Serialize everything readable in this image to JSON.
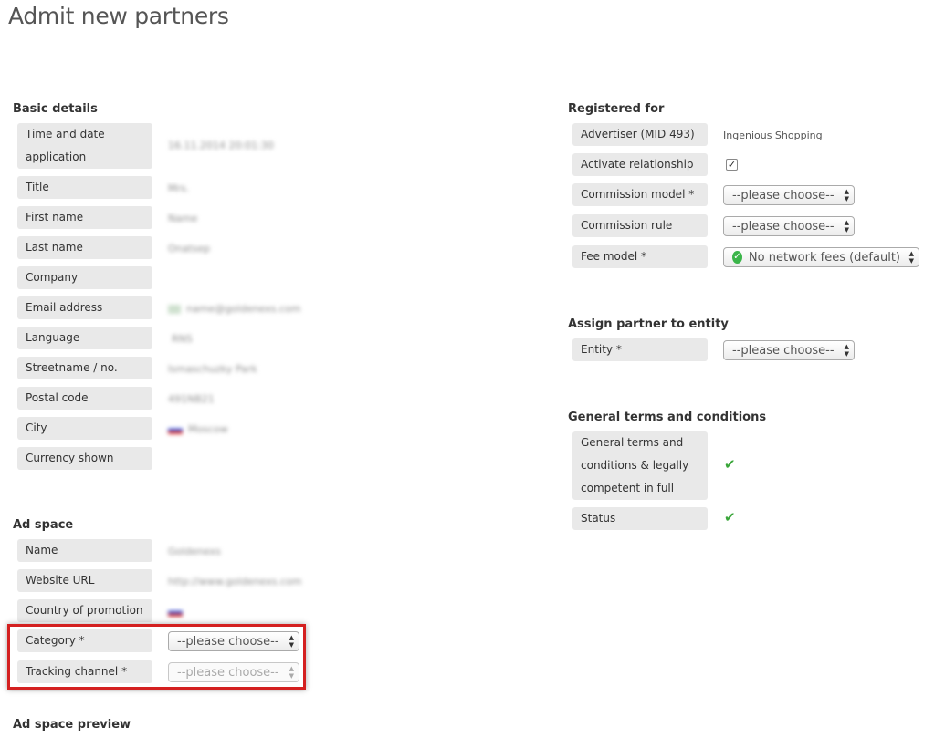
{
  "page": {
    "title": "Admit new partners"
  },
  "basic_details": {
    "heading": "Basic details",
    "fields": [
      {
        "label_line1": "Time and date",
        "label_line2": "application",
        "value": "16.11.2014 20:01:30"
      },
      {
        "label": "Title",
        "value": "Mrs."
      },
      {
        "label": "First name",
        "value": "Name"
      },
      {
        "label": "Last name",
        "value": "Onatsep"
      },
      {
        "label": "Company",
        "value": ""
      },
      {
        "label": "Email address",
        "value": "name@goldenexs.com"
      },
      {
        "label": "Language",
        "value": "RNS"
      },
      {
        "label": "Streetname / no.",
        "value": "Ismaschuzky Park"
      },
      {
        "label": "Postal code",
        "value": "491NB21"
      },
      {
        "label": "City",
        "value": "Moscow"
      },
      {
        "label": "Currency shown",
        "value": ""
      }
    ]
  },
  "ad_space": {
    "heading": "Ad space",
    "fields": [
      {
        "label": "Name",
        "value": "Goldenexs"
      },
      {
        "label": "Website URL",
        "value": "http://www.goldenexs.com"
      },
      {
        "label": "Country of promotion",
        "value": ""
      },
      {
        "label": "Category *",
        "select": "--please choose--"
      },
      {
        "label": "Tracking channel *",
        "select": "--please choose--"
      }
    ]
  },
  "ad_space_preview": {
    "heading": "Ad space preview"
  },
  "registered_for": {
    "heading": "Registered for",
    "advertiser_label": "Advertiser (MID 493)",
    "advertiser_value": "Ingenious Shopping",
    "activate_label": "Activate relationship",
    "activate_checked": true,
    "activate_mark": "✓",
    "commission_model_label": "Commission model *",
    "commission_model_select": "--please choose--",
    "commission_rule_label": "Commission rule",
    "commission_rule_select": "--please choose--",
    "fee_model_label": "Fee model *",
    "fee_model_select": "No network fees (default)"
  },
  "assign_entity": {
    "heading": "Assign partner to entity",
    "entity_label": "Entity *",
    "entity_select": "--please choose--"
  },
  "terms": {
    "heading": "General terms and conditions",
    "gtc_line1": "General terms and",
    "gtc_line2": "conditions & legally",
    "gtc_line3": "competent in full",
    "status_label": "Status",
    "check_mark": "✔"
  },
  "icons": {
    "select_arrows": "⇕",
    "check": "check-icon",
    "flag": "flag-icon"
  },
  "colors": {
    "label_bg": "#e9e9e9",
    "highlight": "#d42020",
    "check_green": "#3aa63a"
  }
}
